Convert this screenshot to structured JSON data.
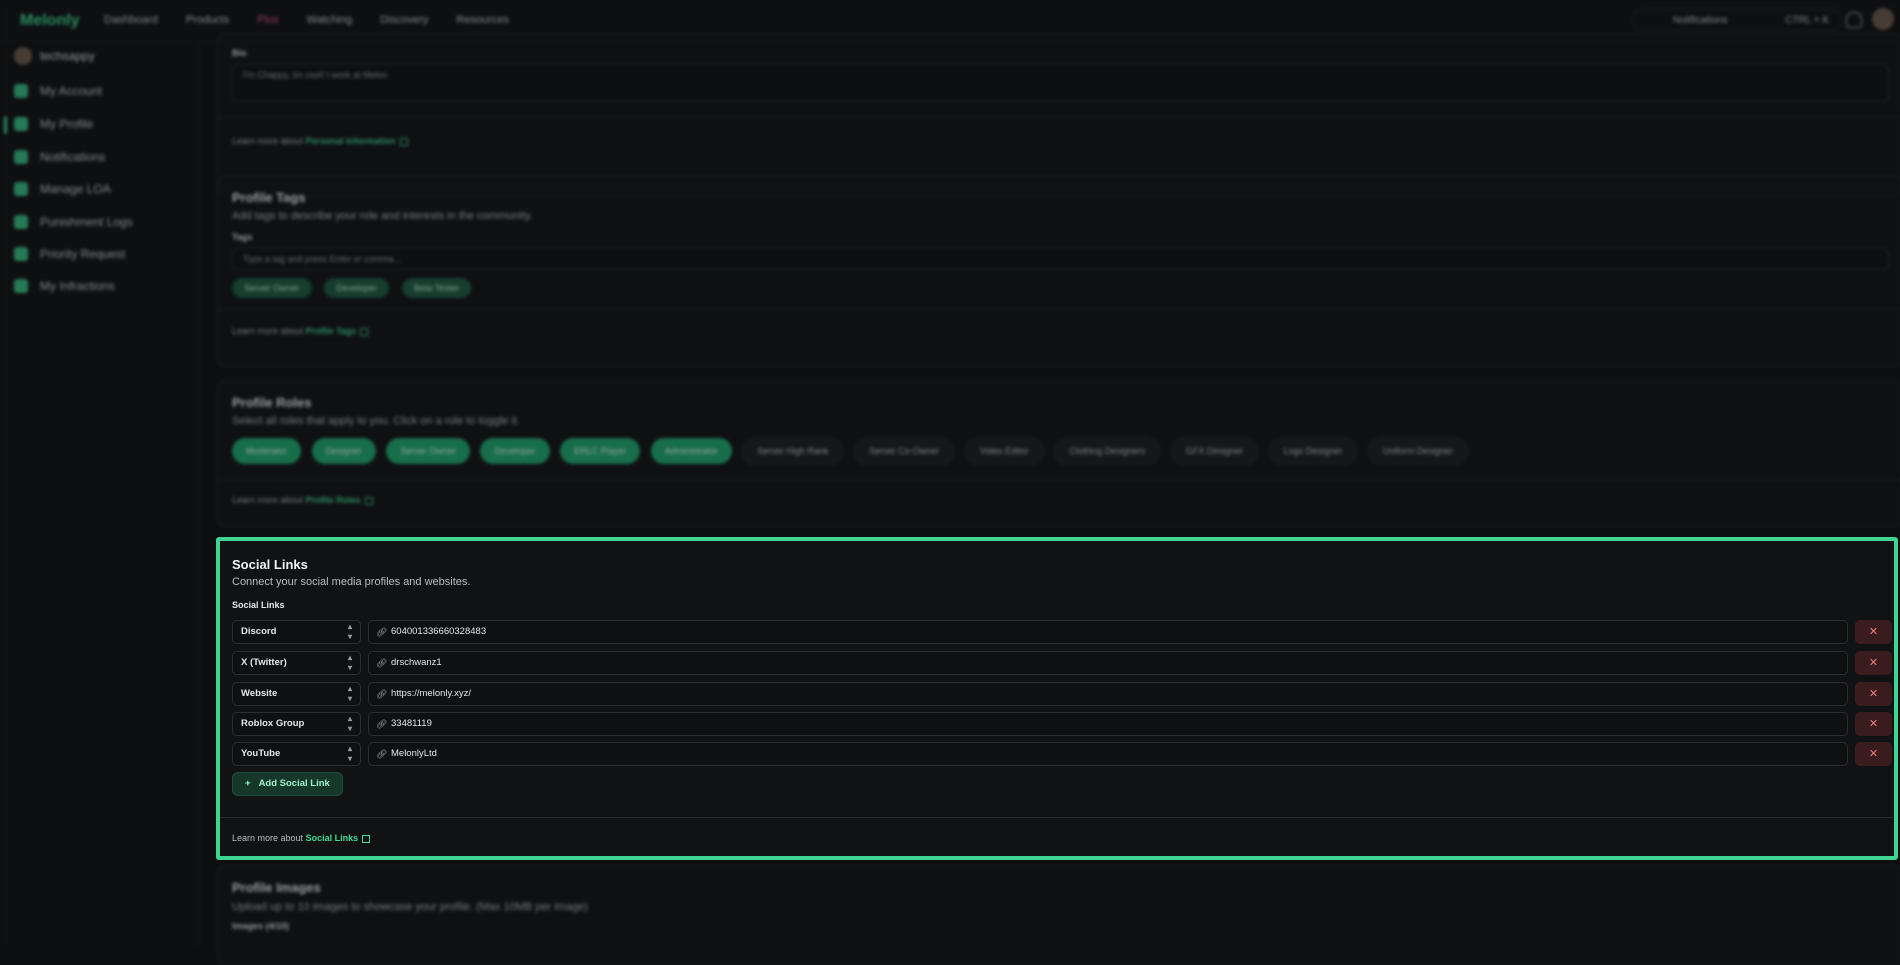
{
  "topnav": {
    "logo": "Melonly",
    "items": [
      "Dashboard",
      "Products",
      "Plus",
      "Watching",
      "Discovery",
      "Resources"
    ],
    "search_text": "Notifications",
    "search_shortcut": "CTRL + K"
  },
  "sidebar": {
    "username": "techsappy",
    "items": [
      "My Account",
      "My Profile",
      "Notifications",
      "Manage LOA",
      "Punishment Logs",
      "Priority Request",
      "My Infractions"
    ]
  },
  "bio": {
    "label": "Bio",
    "value": "I'm Chappy, Im cool! I work at Melon",
    "learn_prefix": "Learn more about",
    "learn_link": "Personal Information"
  },
  "profile_tags": {
    "title": "Profile Tags",
    "description": "Add tags to describe your role and interests in the community.",
    "label": "Tags",
    "placeholder": "Type a tag and press Enter or comma...",
    "tags": [
      "Server Owner",
      "Developer",
      "Beta Tester"
    ],
    "learn_prefix": "Learn more about",
    "learn_link": "Profile Tags"
  },
  "profile_roles": {
    "title": "Profile Roles",
    "description": "Select all roles that apply to you. Click on a role to toggle it.",
    "active": [
      "Moderator",
      "Designer",
      "Server Owner",
      "Developer",
      "ERLC Player",
      "Administrator"
    ],
    "inactive": [
      "Server High Rank",
      "Server Co-Owner",
      "Video Editor",
      "Clothing Designers",
      "GFX Designer",
      "Logo Designer",
      "Uniform Designer"
    ],
    "learn_prefix": "Learn more about",
    "learn_link": "Profile Roles"
  },
  "social_links": {
    "title": "Social Links",
    "description": "Connect your social media profiles and websites.",
    "label": "Social Links",
    "links": [
      {
        "platform": "Discord",
        "value": "604001336660328483"
      },
      {
        "platform": "X (Twitter)",
        "value": "drschwanz1"
      },
      {
        "platform": "Website",
        "value": "https://melonly.xyz/"
      },
      {
        "platform": "Roblox Group",
        "value": "33481119"
      },
      {
        "platform": "YouTube",
        "value": "MelonlyLtd"
      }
    ],
    "add_label": "Add Social Link",
    "learn_prefix": "Learn more about",
    "learn_link": "Social Links"
  },
  "profile_images": {
    "title": "Profile Images",
    "description": "Upload up to 10 images to showcase your profile. (Max 10MB per image)",
    "label": "Images (4/10)"
  },
  "colors": {
    "accent": "#3ddc97",
    "highlight_border": "#3fd394",
    "delete_bg": "#3a1c1f"
  }
}
